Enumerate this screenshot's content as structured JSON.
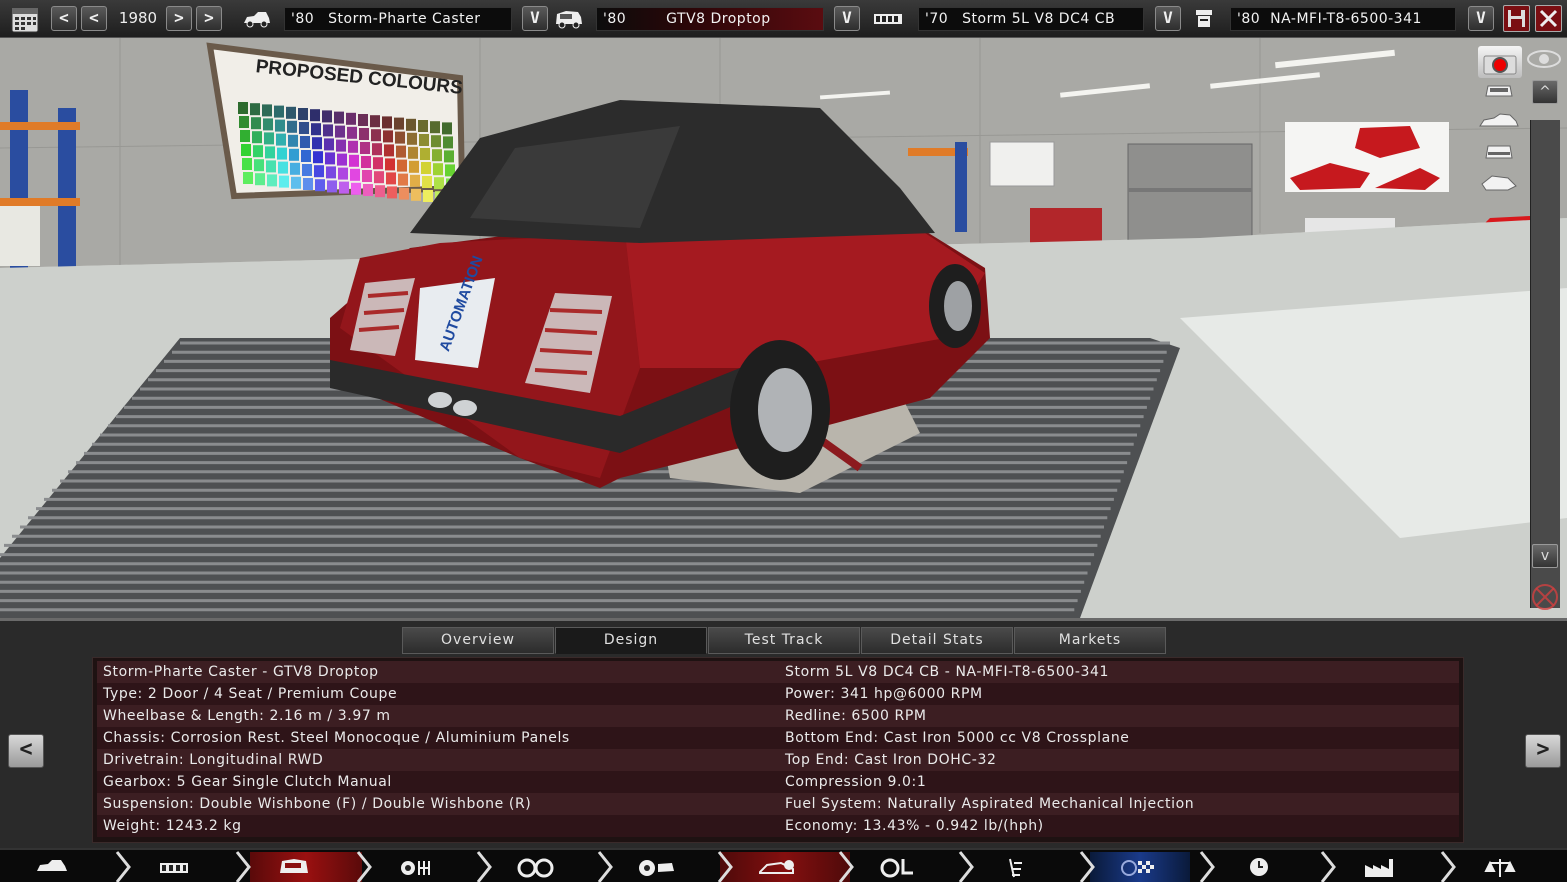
{
  "topbar": {
    "year": "1980",
    "prev_label": "<",
    "prev2_label": "<",
    "next_label": ">",
    "next2_label": ">",
    "model": {
      "year": "'80",
      "name": "Storm-Pharte Caster"
    },
    "trim": {
      "year": "'80",
      "name": "GTV8 Droptop"
    },
    "engine_family": {
      "year": "'70",
      "name": "Storm 5L V8 DC4 CB"
    },
    "engine_variant": {
      "year": "'80",
      "name": "NA-MFI-T8-6500-341"
    },
    "dropdown_label": "V",
    "icons": [
      "calendar-icon",
      "car-model-icon",
      "car-trim-icon",
      "engine-family-icon",
      "engine-variant-icon",
      "save-icon",
      "close-icon"
    ]
  },
  "scene": {
    "poster_title": "PROPOSED COLOURS",
    "plate_text": "AUTOMATION"
  },
  "side_toolbar": {
    "icons": [
      "camera-icon",
      "car-front-view-icon",
      "car-side-view-icon",
      "car-rear-view-icon",
      "car-angle-view-icon",
      "eye-icon",
      "scroll-up-icon",
      "scroll-down-icon",
      "no-drag-icon"
    ],
    "up_label": "^",
    "down_label": "v"
  },
  "panel": {
    "tabs": [
      "Overview",
      "Design",
      "Test Track",
      "Detail Stats",
      "Markets"
    ],
    "active_tab": "Design",
    "prev_label": "<",
    "next_label": ">",
    "left_column": [
      "Storm-Pharte Caster - GTV8 Droptop",
      "Type: 2 Door / 4 Seat / Premium Coupe",
      "Wheelbase & Length: 2.16 m / 3.97 m",
      "Chassis: Corrosion Rest. Steel Monocoque / Aluminium Panels",
      "Drivetrain: Longitudinal RWD",
      "Gearbox: 5 Gear Single Clutch Manual",
      "Suspension: Double Wishbone (F) / Double Wishbone (R)",
      "Weight: 1243.2 kg"
    ],
    "right_column": [
      "Storm 5L V8 DC4 CB - NA-MFI-T8-6500-341",
      "Power: 341 hp@6000 RPM",
      "Redline: 6500 RPM",
      "Bottom End: Cast Iron 5000 cc V8 Crossplane",
      "Top End: Cast Iron DOHC-32",
      "Compression 9.0:1",
      "Fuel System: Naturally Aspirated Mechanical Injection",
      "Economy: 13.43% - 0.942 lb/(hph)"
    ]
  },
  "navbar": {
    "steps": [
      "car-body-icon",
      "chassis-icon",
      "trim-select-icon",
      "engine-gears-icon",
      "wheels-icon",
      "brakes-aero-icon",
      "car-design-fan-icon",
      "interior-steering-icon",
      "suspension-tuning-icon",
      "test-track-icon",
      "engineering-time-icon",
      "factory-icon",
      "markets-scale-icon"
    ],
    "brand_color": "#9a1010"
  },
  "colors": {
    "accent_red": "#9a1010",
    "panel_row_odd": "#3c1e22",
    "panel_row_even": "#2e1418"
  }
}
